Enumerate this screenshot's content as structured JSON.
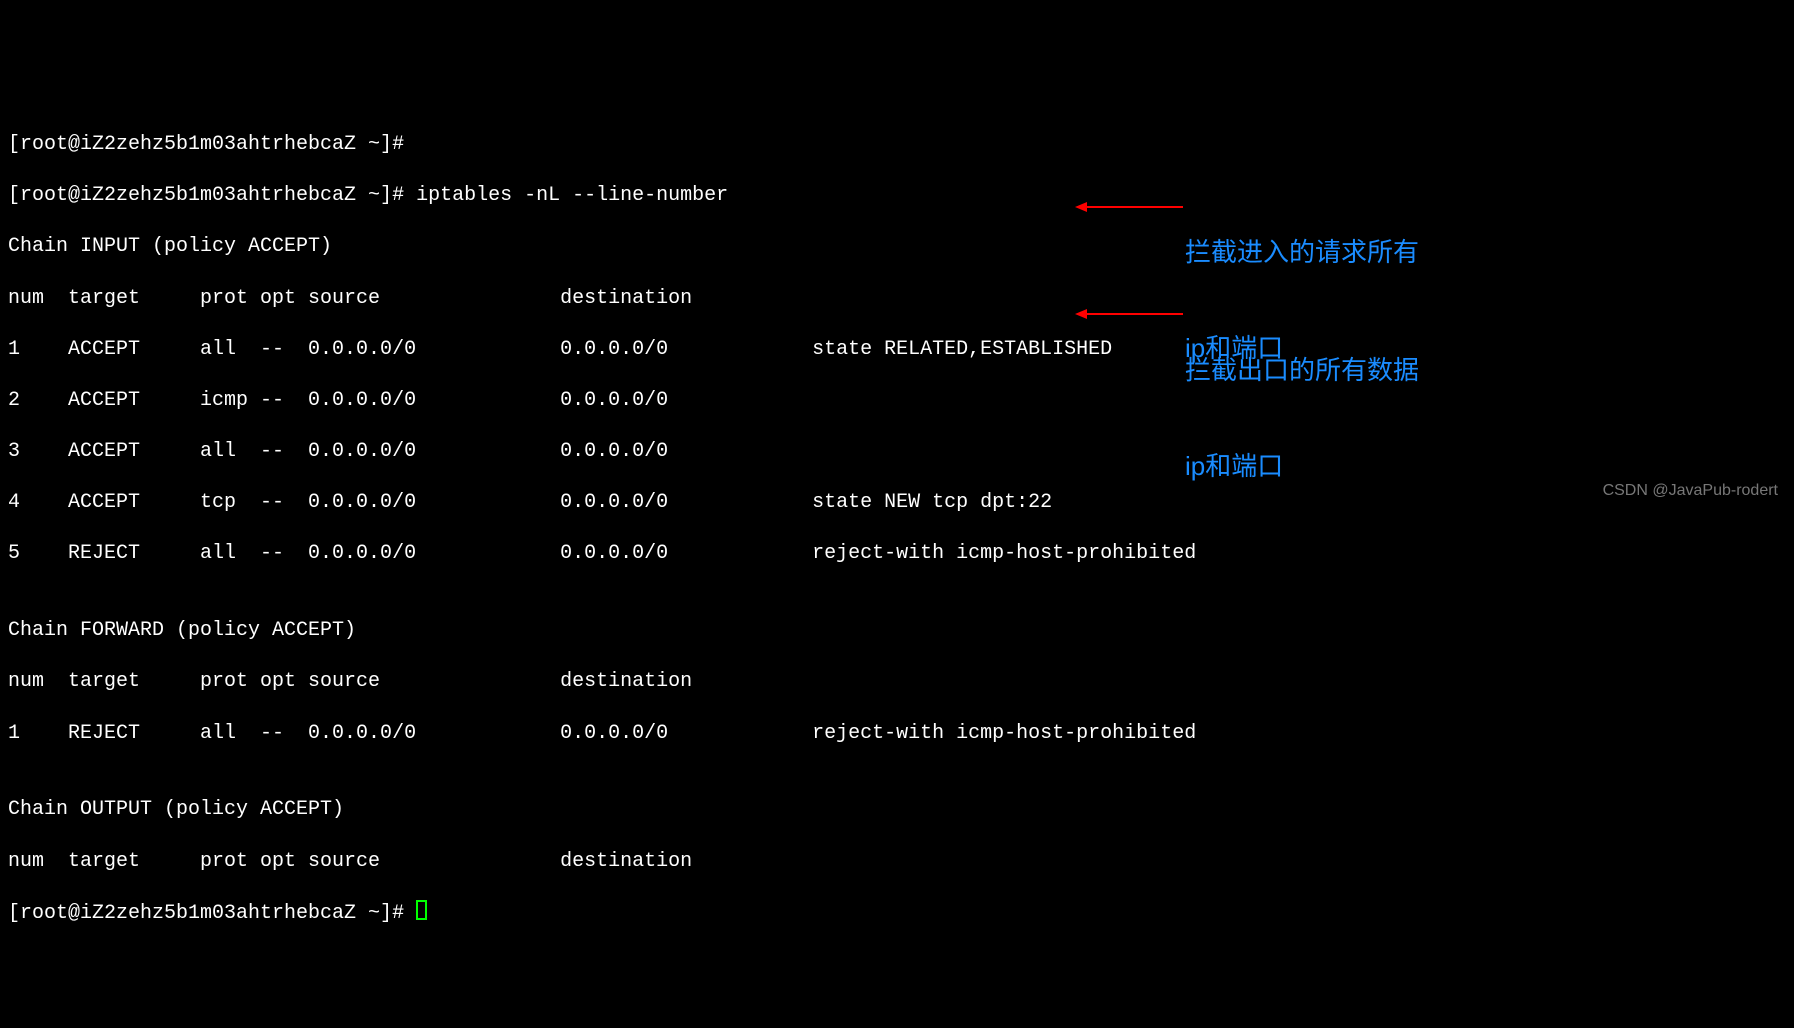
{
  "prompt": "[root@iZ2zehz5b1m03ahtrhebcaZ ~]#",
  "command": " iptables -nL --line-number",
  "chain_input_header": "Chain INPUT (policy ACCEPT)",
  "columns_header": "num  target     prot opt source               destination",
  "input_rows": [
    "1    ACCEPT     all  --  0.0.0.0/0            0.0.0.0/0            state RELATED,ESTABLISHED",
    "2    ACCEPT     icmp --  0.0.0.0/0            0.0.0.0/0",
    "3    ACCEPT     all  --  0.0.0.0/0            0.0.0.0/0",
    "4    ACCEPT     tcp  --  0.0.0.0/0            0.0.0.0/0            state NEW tcp dpt:22",
    "5    REJECT     all  --  0.0.0.0/0            0.0.0.0/0            reject-with icmp-host-prohibited"
  ],
  "chain_forward_header": "Chain FORWARD (policy ACCEPT)",
  "forward_rows": [
    "1    REJECT     all  --  0.0.0.0/0            0.0.0.0/0            reject-with icmp-host-prohibited"
  ],
  "chain_output_header": "Chain OUTPUT (policy ACCEPT)",
  "blank": "",
  "annotation1_line1": "拦截进入的请求所有",
  "annotation1_line2": "ip和端口",
  "annotation2_line1": "拦截出口的所有数据",
  "annotation2_line2": "ip和端口",
  "watermark": "CSDN @JavaPub-rodert"
}
